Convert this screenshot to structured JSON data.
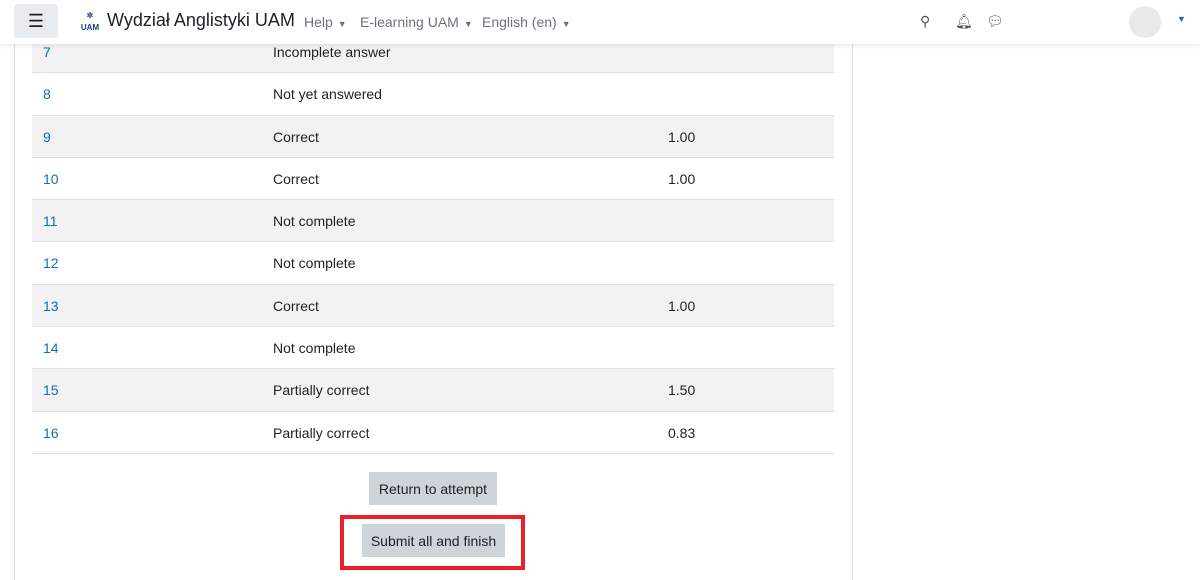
{
  "navbar": {
    "site_name": "Wydział Anglistyki UAM",
    "logo_text": "UAM",
    "menus": [
      "Help",
      "E-learning UAM",
      "English (en)"
    ],
    "icons": [
      "search-icon",
      "bell-icon",
      "chat-icon"
    ]
  },
  "summary": {
    "rows": [
      {
        "question": "7",
        "status": "Incomplete answer",
        "marks": ""
      },
      {
        "question": "8",
        "status": "Not yet answered",
        "marks": ""
      },
      {
        "question": "9",
        "status": "Correct",
        "marks": "1.00"
      },
      {
        "question": "10",
        "status": "Correct",
        "marks": "1.00"
      },
      {
        "question": "11",
        "status": "Not complete",
        "marks": ""
      },
      {
        "question": "12",
        "status": "Not complete",
        "marks": ""
      },
      {
        "question": "13",
        "status": "Correct",
        "marks": "1.00"
      },
      {
        "question": "14",
        "status": "Not complete",
        "marks": ""
      },
      {
        "question": "15",
        "status": "Partially correct",
        "marks": "1.50"
      },
      {
        "question": "16",
        "status": "Partially correct",
        "marks": "0.83"
      }
    ]
  },
  "buttons": {
    "return": "Return to attempt",
    "submit": "Submit all and finish"
  },
  "colors": {
    "link": "#0f6cbf",
    "highlight": "#e8202a",
    "button": "#ced4da"
  }
}
